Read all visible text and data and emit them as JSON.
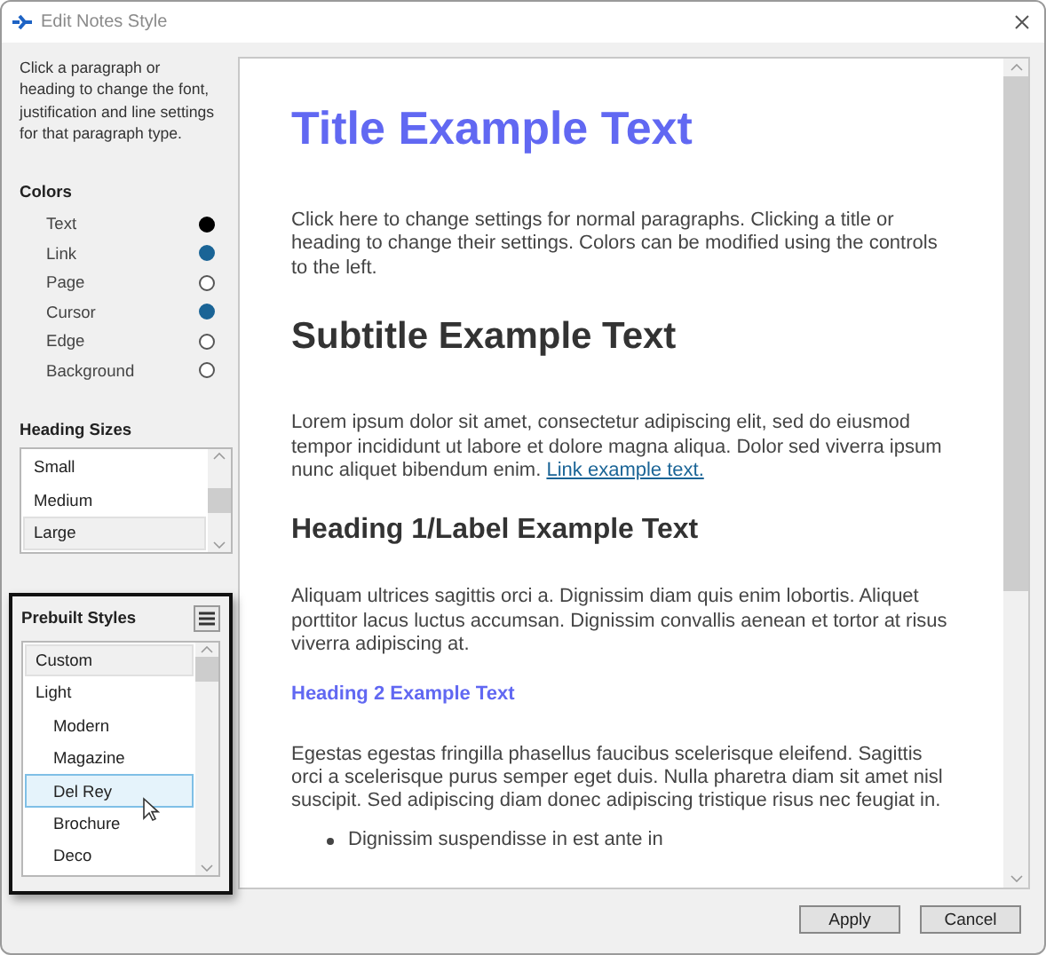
{
  "window": {
    "title": "Edit Notes Style"
  },
  "instructions": "Click a paragraph or heading to change the font, justification and line settings for that paragraph type.",
  "colors": {
    "title": "Colors",
    "items": [
      {
        "label": "Text",
        "color": "#000000"
      },
      {
        "label": "Link",
        "color": "#1a6496"
      },
      {
        "label": "Page",
        "color": "#ffffff"
      },
      {
        "label": "Cursor",
        "color": "#1a6496"
      },
      {
        "label": "Edge",
        "color": "#ffffff"
      },
      {
        "label": "Background",
        "color": "#ffffff"
      }
    ]
  },
  "heading_sizes": {
    "title": "Heading Sizes",
    "items": [
      {
        "label": "Small",
        "selected": false
      },
      {
        "label": "Medium",
        "selected": false
      },
      {
        "label": "Large",
        "selected": true
      }
    ]
  },
  "prebuilt_styles": {
    "title": "Prebuilt Styles",
    "items": [
      {
        "label": "Custom",
        "selected": true,
        "hovered": false
      },
      {
        "label": "Light",
        "selected": false,
        "hovered": false,
        "children": [
          {
            "label": "Modern",
            "selected": false,
            "hovered": false
          },
          {
            "label": "Magazine",
            "selected": false,
            "hovered": false
          },
          {
            "label": "Del Rey",
            "selected": false,
            "hovered": true
          },
          {
            "label": "Brochure",
            "selected": false,
            "hovered": false
          },
          {
            "label": "Deco",
            "selected": false,
            "hovered": false
          }
        ]
      }
    ]
  },
  "preview": [
    {
      "kind": "title",
      "text": "Title Example Text"
    },
    {
      "kind": "paragraph",
      "text": "Click here to change settings for normal paragraphs. Clicking a title or heading to change their settings. Colors can be modified using the controls to the left."
    },
    {
      "kind": "subtitle",
      "text": "Subtitle Example Text"
    },
    {
      "kind": "paragraph",
      "text": "Lorem ipsum dolor sit amet, consectetur adipiscing elit, sed do eiusmod tempor incididunt ut labore et dolore magna aliqua. Dolor sed viverra ipsum nunc aliquet bibendum enim.",
      "link": "Link example text."
    },
    {
      "kind": "heading1",
      "text": "Heading 1/Label Example Text"
    },
    {
      "kind": "paragraph",
      "text": "Aliquam ultrices sagittis orci a. Dignissim diam quis enim lobortis. Aliquet porttitor lacus luctus accumsan. Dignissim convallis aenean et tortor at risus viverra adipiscing at."
    },
    {
      "kind": "heading2",
      "text": "Heading 2 Example Text"
    },
    {
      "kind": "paragraph",
      "text": "Egestas egestas fringilla phasellus faucibus scelerisque eleifend. Sagittis orci a scelerisque purus semper eget duis. Nulla pharetra diam sit amet nisl suscipit. Sed adipiscing diam donec adipiscing tristique risus nec feugiat in."
    },
    {
      "kind": "bullet",
      "text": "Dignissim suspendisse in est ante in"
    }
  ],
  "buttons": [
    "Apply",
    "Cancel"
  ]
}
